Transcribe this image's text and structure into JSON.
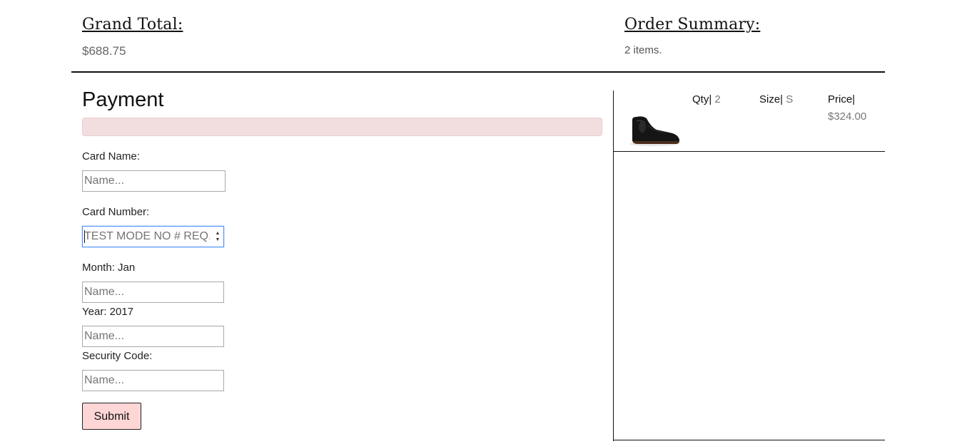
{
  "header": {
    "grand_total_title": "Grand Total:",
    "grand_total_value": "$688.75",
    "order_summary_title": "Order Summary:",
    "order_summary_count": "2 items."
  },
  "payment": {
    "title": "Payment",
    "card_name_label": "Card Name:",
    "card_name_placeholder": "Name...",
    "card_number_label": "Card Number:",
    "card_number_placeholder": "TEST MODE NO # REQ.",
    "month_label": "Month: Jan",
    "month_placeholder": "Name...",
    "year_label": "Year: 2017",
    "year_placeholder": "Name...",
    "security_label": "Security Code:",
    "security_placeholder": "Name...",
    "submit_label": "Submit"
  },
  "order_item": {
    "qty_label": "Qty|",
    "qty_value": "2",
    "size_label": "Size|",
    "size_value": "S",
    "price_label": "Price|",
    "price_value": "$324.00"
  },
  "colors": {
    "alert_bg": "#f2dede",
    "submit_bg": "#ffd6d6",
    "focus_border": "#4d90fe"
  }
}
